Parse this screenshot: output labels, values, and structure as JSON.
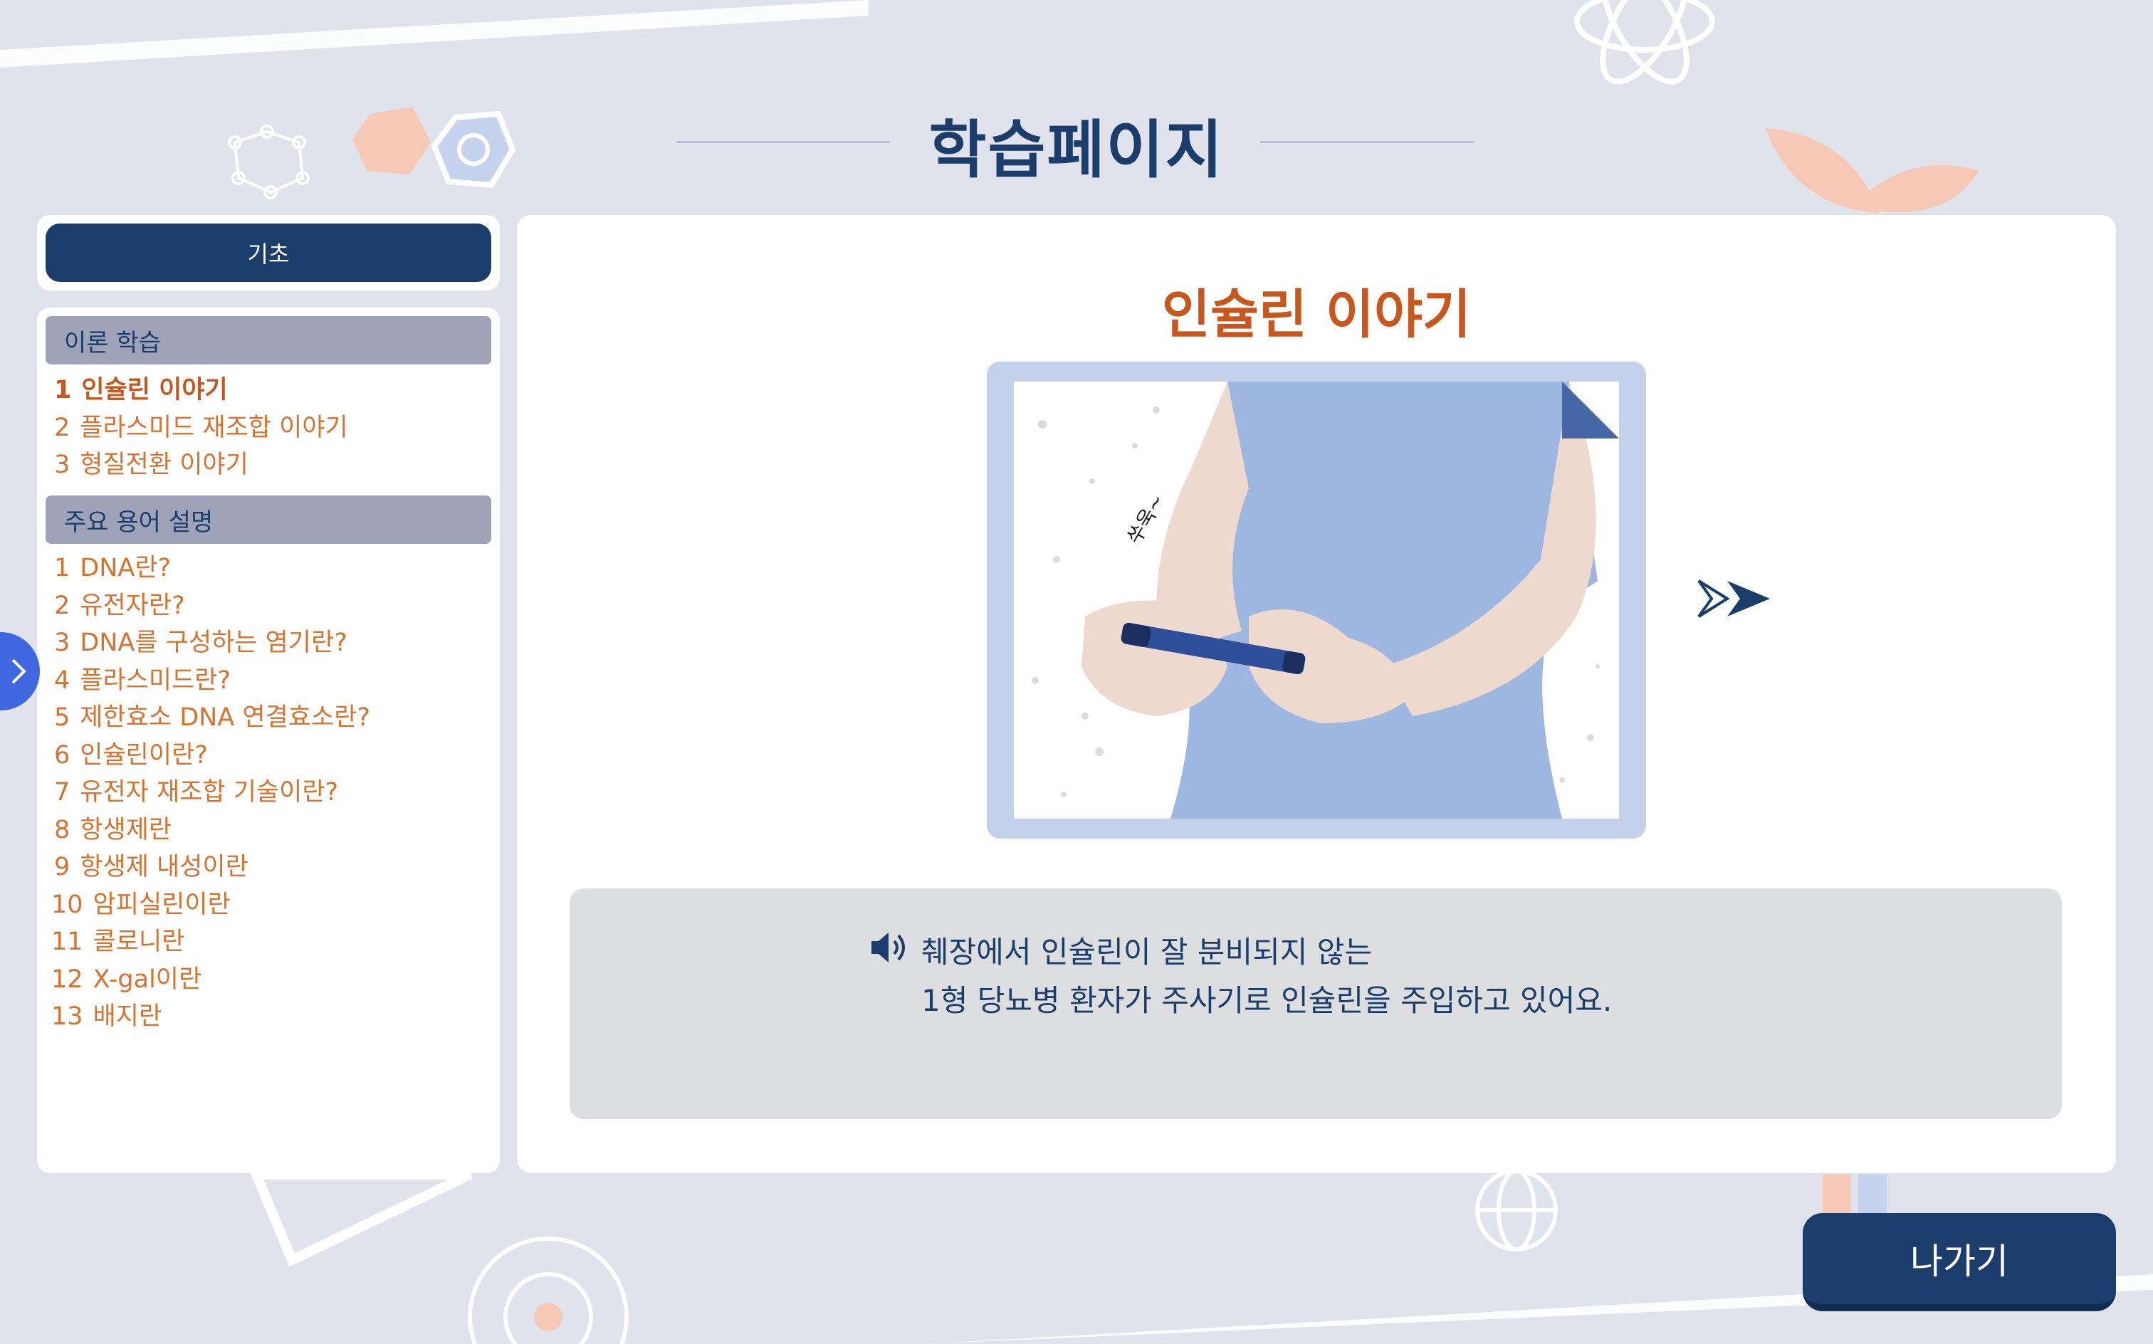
{
  "header": {
    "title": "학습페이지"
  },
  "sidebar": {
    "level_label": "기초",
    "sections": [
      {
        "title": "이론 학습",
        "items": [
          {
            "num": "1",
            "label": "인슐린 이야기"
          },
          {
            "num": "2",
            "label": "플라스미드 재조합 이야기"
          },
          {
            "num": "3",
            "label": "형질전환 이야기"
          }
        ]
      },
      {
        "title": "주요 용어 설명",
        "items": [
          {
            "num": "1",
            "label": "DNA란?"
          },
          {
            "num": "2",
            "label": "유전자란?"
          },
          {
            "num": "3",
            "label": "DNA를 구성하는 염기란?"
          },
          {
            "num": "4",
            "label": "플라스미드란?"
          },
          {
            "num": "5",
            "label": "제한효소 DNA 연결효소란?"
          },
          {
            "num": "6",
            "label": "인슐린이란?"
          },
          {
            "num": "7",
            "label": "유전자 재조합 기술이란?"
          },
          {
            "num": "8",
            "label": "항생제란"
          },
          {
            "num": "9",
            "label": "항생제 내성이란"
          },
          {
            "num": "10",
            "label": "암피실린이란"
          },
          {
            "num": "11",
            "label": "콜로니란"
          },
          {
            "num": "12",
            "label": "X-gal이란"
          },
          {
            "num": "13",
            "label": "배지란"
          }
        ]
      }
    ]
  },
  "main": {
    "lesson_title": "인슐린 이야기",
    "illustration_text": "쑤욱~",
    "caption": [
      "췌장에서 인슐린이 잘 분비되지 않는",
      "1형 당뇨병 환자가 주사기로 인슐린을 주입하고 있어요."
    ]
  },
  "footer": {
    "exit_label": "나가기"
  },
  "colors": {
    "navy": "#1b3d6b",
    "orange": "#d7722f",
    "active_orange": "#c8571d",
    "section_gray": "#9ea3b8",
    "toggle_blue": "#3e67e0",
    "background": "#e0e3ec"
  }
}
